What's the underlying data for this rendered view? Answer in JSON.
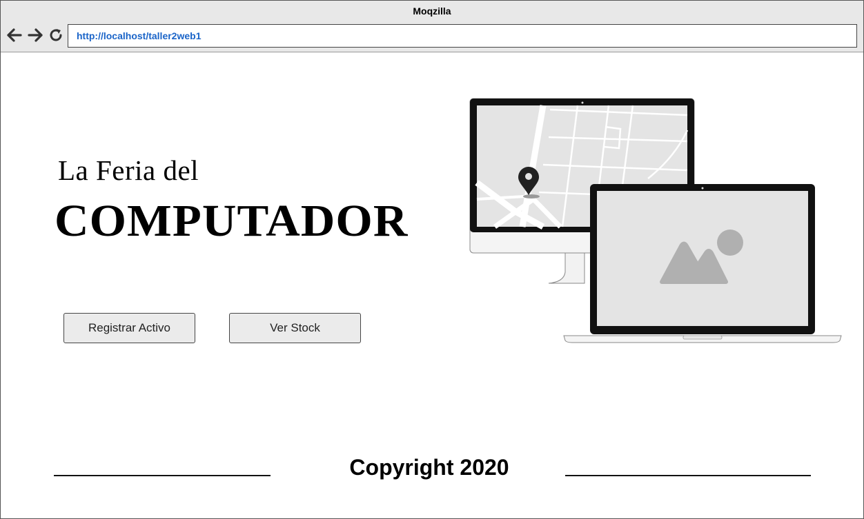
{
  "browser": {
    "title": "Moqzilla",
    "url": "http://localhost/taller2web1",
    "nav_icons": [
      "back-arrow-icon",
      "forward-arrow-icon",
      "reload-icon"
    ]
  },
  "hero": {
    "line1": "La Feria del",
    "line2": "COMPUTADOR"
  },
  "actions": {
    "register_label": "Registrar Activo",
    "stock_label": "Ver Stock"
  },
  "illustration": {
    "icons": [
      "map-pin-icon",
      "image-placeholder-icon"
    ]
  },
  "footer": {
    "copyright": "Copyright 2020"
  }
}
